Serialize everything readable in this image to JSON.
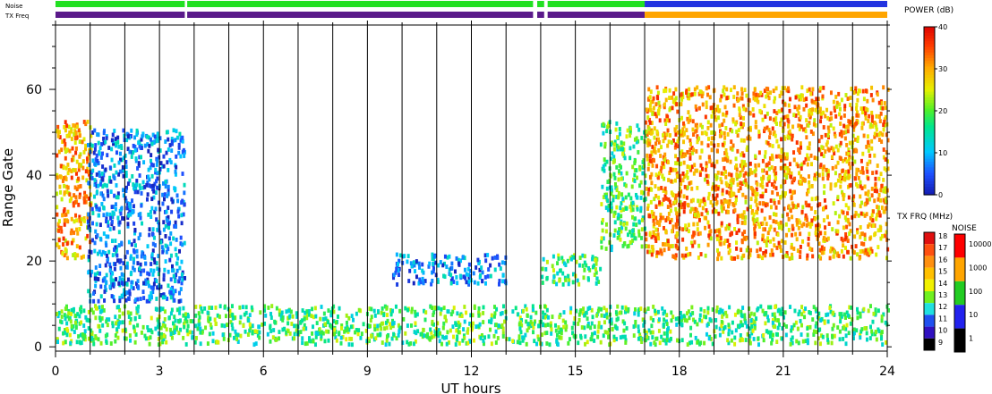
{
  "chart_data": {
    "type": "heatmap",
    "xlabel": "UT hours",
    "ylabel": "Range Gate",
    "xlim": [
      0,
      24
    ],
    "ylim": [
      -1,
      75
    ],
    "xticks": [
      0,
      3,
      6,
      9,
      12,
      15,
      18,
      21,
      24
    ],
    "yticks": [
      0,
      20,
      40,
      60
    ],
    "grid_x": "vertical line every hour",
    "status_bars": {
      "noise_label": "Noise",
      "txfreq_label": "TX Freq",
      "noise_segments": [
        {
          "start": 0,
          "end": 3.73,
          "color": "#22e022"
        },
        {
          "start": 3.8,
          "end": 13.78,
          "color": "#22e022"
        },
        {
          "start": 13.9,
          "end": 14.1,
          "color": "#22e022"
        },
        {
          "start": 14.2,
          "end": 17.0,
          "color": "#22e022"
        },
        {
          "start": 17.0,
          "end": 24.0,
          "color": "#2233e0"
        }
      ],
      "txfreq_segments": [
        {
          "start": 0,
          "end": 3.73,
          "color": "#5a1a8a"
        },
        {
          "start": 3.8,
          "end": 13.78,
          "color": "#5a1a8a"
        },
        {
          "start": 13.9,
          "end": 14.1,
          "color": "#5a1a8a"
        },
        {
          "start": 14.2,
          "end": 17.0,
          "color": "#5a1a8a"
        },
        {
          "start": 17.0,
          "end": 24.0,
          "color": "#ffa500"
        }
      ]
    },
    "power_scale": {
      "title": "POWER (dB)",
      "min": 0,
      "max": 40,
      "ticks": [
        0,
        10,
        20,
        30,
        40
      ]
    },
    "txfreq_scale": {
      "title": "TX FRQ (MHz)",
      "labels": [
        "18",
        "17",
        "16",
        "15",
        "14",
        "13",
        "12",
        "11",
        "10",
        "9"
      ],
      "colors": [
        "#e01010",
        "#ff5010",
        "#ff9010",
        "#ffc000",
        "#f0f000",
        "#70f020",
        "#20e0e0",
        "#2050f0",
        "#3010c0",
        "#000000"
      ]
    },
    "noise_scale": {
      "title": "NOISE",
      "labels": [
        "10000",
        "1000",
        "100",
        "10",
        "1"
      ],
      "colors": [
        "#ff0000",
        "#ffa500",
        "#22cc22",
        "#2222ee",
        "#000000"
      ]
    },
    "echo_regions": [
      {
        "t0": 0.0,
        "t1": 1.0,
        "g0": 20,
        "g1": 52,
        "power": "high",
        "note": "early echoes, red at gate 20-24"
      },
      {
        "t0": 0.9,
        "t1": 3.7,
        "g0": 10,
        "g1": 50,
        "power": "low",
        "note": "descending blue cloud"
      },
      {
        "t0": 9.7,
        "t1": 13.0,
        "g0": 14,
        "g1": 21,
        "power": "low"
      },
      {
        "t0": 14.0,
        "t1": 15.7,
        "g0": 14,
        "g1": 21,
        "power": "medium"
      },
      {
        "t0": 15.7,
        "t1": 17.0,
        "g0": 22,
        "g1": 52,
        "power": "medium"
      },
      {
        "t0": 17.0,
        "t1": 24.0,
        "g0": 20,
        "g1": 60,
        "power": "high",
        "note": "strong band peaking near gate 25-40"
      },
      {
        "t0": 0.0,
        "t1": 24.0,
        "g0": 0,
        "g1": 9,
        "power": "medium",
        "note": "near-range clutter"
      }
    ]
  }
}
